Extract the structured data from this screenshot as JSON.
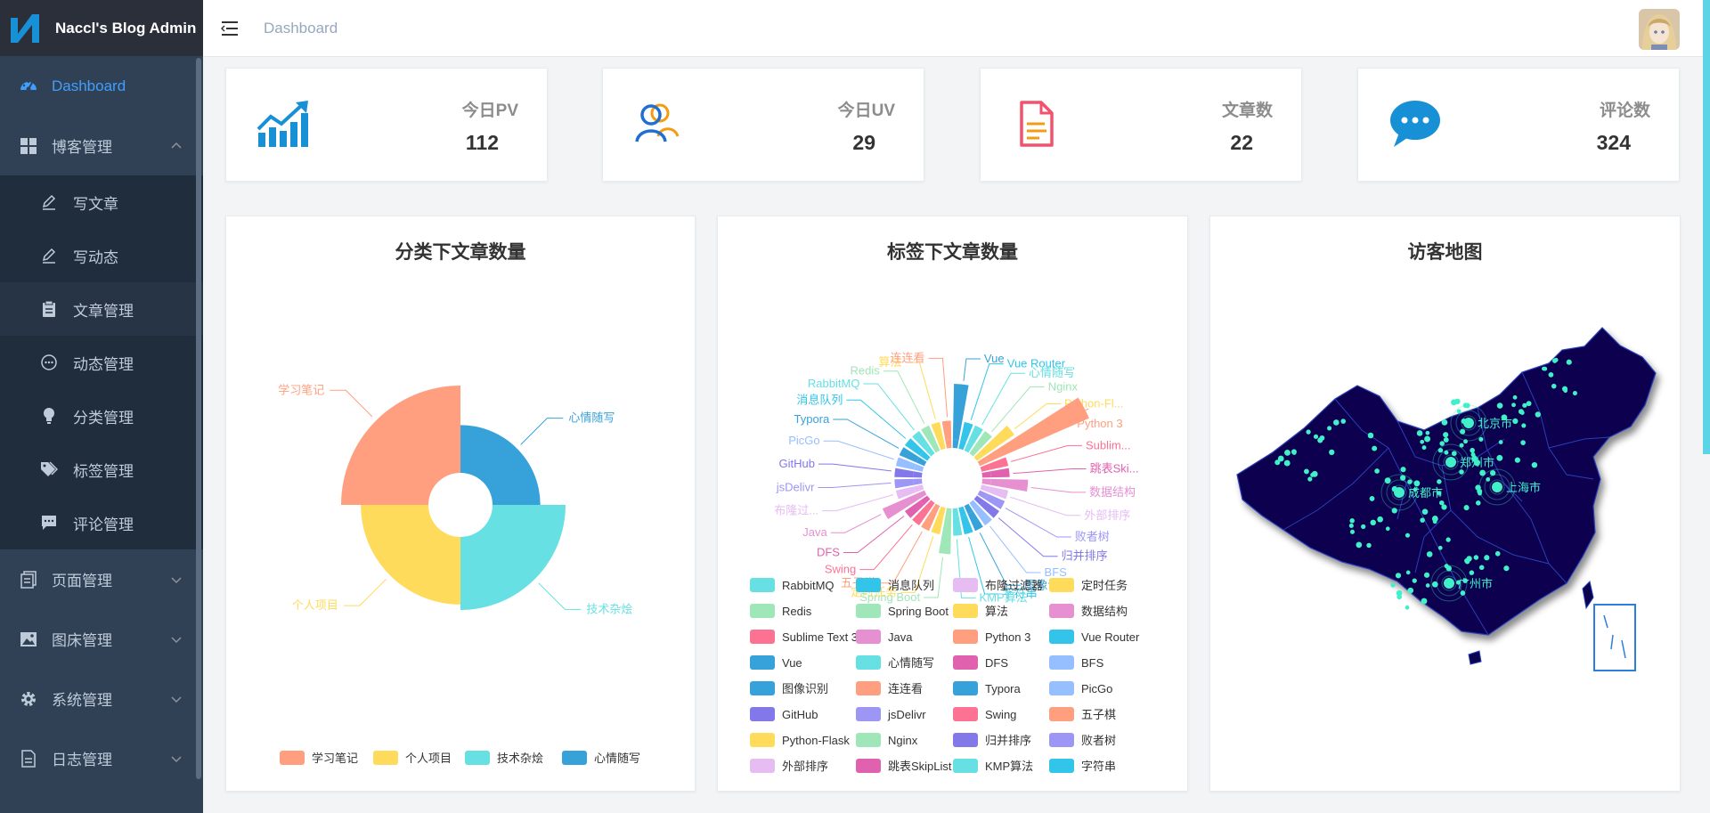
{
  "app": {
    "title": "Naccl's Blog Admin"
  },
  "header": {
    "breadcrumb": "Dashboard"
  },
  "sidebar": {
    "items": [
      {
        "label": "Dashboard",
        "icon": "dashboard-icon",
        "active": true
      },
      {
        "label": "博客管理",
        "icon": "grid-icon",
        "expanded": true
      },
      {
        "label": "页面管理",
        "icon": "page-icon"
      },
      {
        "label": "图床管理",
        "icon": "image-icon"
      },
      {
        "label": "系统管理",
        "icon": "gear-icon"
      },
      {
        "label": "日志管理",
        "icon": "log-icon"
      }
    ],
    "blog_sub": [
      {
        "label": "写文章",
        "icon": "pen-icon"
      },
      {
        "label": "写动态",
        "icon": "pen-icon"
      },
      {
        "label": "文章管理",
        "icon": "clipboard-icon",
        "selected": true
      },
      {
        "label": "动态管理",
        "icon": "chat-icon"
      },
      {
        "label": "分类管理",
        "icon": "bulb-icon"
      },
      {
        "label": "标签管理",
        "icon": "tag-icon"
      },
      {
        "label": "评论管理",
        "icon": "comment-icon"
      }
    ]
  },
  "stats": [
    {
      "label": "今日PV",
      "value": "112",
      "icon": "trend-chart-icon",
      "color": "#1890d5"
    },
    {
      "label": "今日UV",
      "value": "29",
      "icon": "users-icon",
      "color": "#1f6fd1"
    },
    {
      "label": "文章数",
      "value": "22",
      "icon": "document-icon",
      "color": "#f4516c"
    },
    {
      "label": "评论数",
      "value": "324",
      "icon": "message-icon",
      "color": "#1890d5"
    }
  ],
  "panels": {
    "category": {
      "title": "分类下文章数量"
    },
    "tag": {
      "title": "标签下文章数量"
    },
    "map": {
      "title": "访客地图"
    }
  },
  "chart_data": [
    {
      "type": "pie",
      "subtype": "rose",
      "title": "分类下文章数量",
      "categories": [
        "学习笔记",
        "个人项目",
        "技术杂烩",
        "心情随写"
      ],
      "values": [
        10,
        6,
        7,
        3
      ],
      "colors": [
        "#ff9f7f",
        "#ffdb5c",
        "#67e0e3",
        "#37a2da"
      ],
      "legend": "bottom"
    },
    {
      "type": "bar",
      "subtype": "polar",
      "title": "标签下文章数量",
      "categories": [
        "Vue",
        "Vue Router",
        "心情随写",
        "Nginx",
        "Python-Flask",
        "Python 3",
        "Sublime Text 3",
        "跳表SkipList",
        "数据结构",
        "外部排序",
        "败者树",
        "归并排序",
        "BFS",
        "图像识别",
        "字符串",
        "KMP算法",
        "Spring Boot",
        "定时任务",
        "五子棋",
        "Swing",
        "DFS",
        "Java",
        "布隆过滤器",
        "jsDelivr",
        "GitHub",
        "PicGo",
        "Typora",
        "消息队列",
        "RabbitMQ",
        "Redis",
        "算法",
        "连连看"
      ],
      "values": [
        3,
        1,
        1,
        1,
        2,
        6,
        1,
        1,
        2,
        1,
        1,
        1,
        1,
        1,
        1,
        1,
        2,
        1,
        1,
        1,
        1,
        2,
        1,
        1,
        1,
        1,
        1,
        1,
        1,
        1,
        1,
        1
      ],
      "colors": [
        "#37a2da",
        "#32c5e9",
        "#67e0e3",
        "#9fe6b8",
        "#ffdb5c",
        "#ff9f7f",
        "#fb7293",
        "#e062ae",
        "#e690d1",
        "#e7bcf3",
        "#9d96f5",
        "#8378ea",
        "#96bfff"
      ],
      "legend": "bottom",
      "legend_order": [
        "RabbitMQ",
        "消息队列",
        "布隆过滤器",
        "定时任务",
        "Redis",
        "Spring Boot",
        "算法",
        "数据结构",
        "Sublime Text 3",
        "Java",
        "Python 3",
        "Vue Router",
        "Vue",
        "心情随写",
        "DFS",
        "BFS",
        "图像识别",
        "连连看",
        "Typora",
        "PicGo",
        "GitHub",
        "jsDelivr",
        "Swing",
        "五子棋",
        "Python-Flask",
        "Nginx",
        "归并排序",
        "败者树",
        "外部排序",
        "跳表SkipList",
        "KMP算法",
        "字符串"
      ],
      "label_display": {
        "Python-Flask": "Python-Fl...",
        "Sublime Text 3": "Sublim...",
        "跳表SkipList": "跳表Ski...",
        "布隆过滤器": "布隆过..."
      }
    },
    {
      "type": "map",
      "title": "访客地图",
      "region": "China",
      "highlights": [
        "北京市",
        "郑州市",
        "成都市",
        "上海市",
        "广州市"
      ]
    }
  ]
}
